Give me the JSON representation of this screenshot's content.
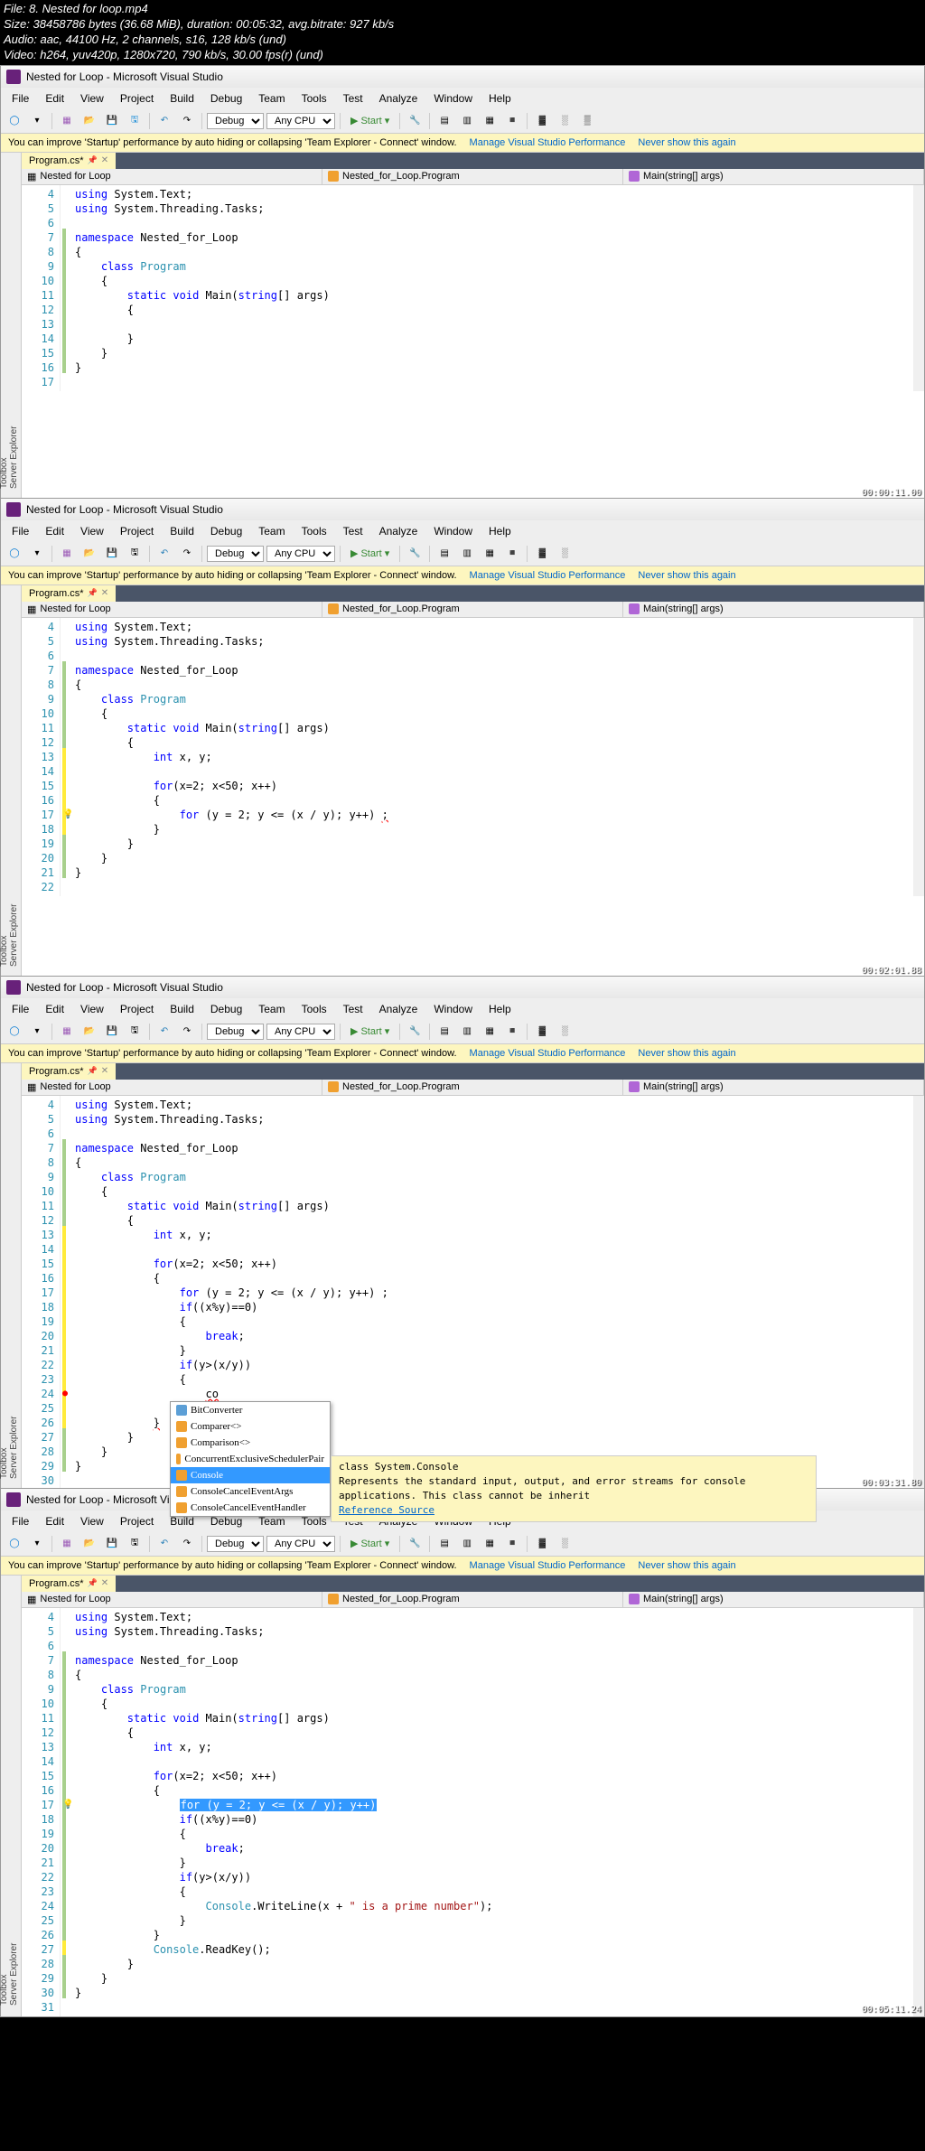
{
  "header": {
    "l1": "File: 8. Nested for loop.mp4",
    "l2": "Size: 38458786 bytes (36.68 MiB), duration: 00:05:32, avg.bitrate: 927 kb/s",
    "l3": "Audio: aac, 44100 Hz, 2 channels, s16, 128 kb/s (und)",
    "l4": "Video: h264, yuv420p, 1280x720, 790 kb/s, 30.00 fps(r) (und)"
  },
  "vs": {
    "title": "Nested for Loop - Microsoft Visual Studio",
    "menu": [
      "File",
      "Edit",
      "View",
      "Project",
      "Build",
      "Debug",
      "Team",
      "Tools",
      "Test",
      "Analyze",
      "Window",
      "Help"
    ],
    "config": "Debug",
    "platform": "Any CPU",
    "start": "Start",
    "info_msg": "You can improve 'Startup' performance by auto hiding or collapsing 'Team Explorer - Connect' window.",
    "info_link1": "Manage Visual Studio Performance",
    "info_link2": "Never show this again",
    "tab": "Program.cs*",
    "nav_scope": "Nested for Loop",
    "nav_class": "Nested_for_Loop.Program",
    "nav_method": "Main(string[] args)",
    "side1": "Server Explorer",
    "side2": "Toolbox"
  },
  "f1": {
    "ts": "00:00:11.00",
    "lines": [
      "4",
      "5",
      "6",
      "7",
      "8",
      "9",
      "10",
      "11",
      "12",
      "13",
      "14",
      "15",
      "16",
      "17"
    ]
  },
  "f2": {
    "ts": "00:02:01.88",
    "lines": [
      "4",
      "5",
      "6",
      "7",
      "8",
      "9",
      "10",
      "11",
      "12",
      "13",
      "14",
      "15",
      "16",
      "17",
      "18",
      "19",
      "20",
      "21",
      "22"
    ]
  },
  "f3": {
    "ts": "00:03:31.80",
    "lines": [
      "4",
      "5",
      "6",
      "7",
      "8",
      "9",
      "10",
      "11",
      "12",
      "13",
      "14",
      "15",
      "16",
      "17",
      "18",
      "19",
      "20",
      "21",
      "22",
      "23",
      "24",
      "25",
      "26",
      "27",
      "28",
      "29",
      "30"
    ],
    "typed": "co",
    "intelli": [
      "BitConverter",
      "Comparer<>",
      "Comparison<>",
      "ConcurrentExclusiveSchedulerPair",
      "Console",
      "ConsoleCancelEventArgs",
      "ConsoleCancelEventHandler"
    ],
    "tip_head": "class System.Console",
    "tip_body": "Represents the standard input, output, and error streams for console applications. This class cannot be inherit",
    "tip_ref": "Reference Source"
  },
  "f4": {
    "ts": "00:05:11.24",
    "lines": [
      "4",
      "5",
      "6",
      "7",
      "8",
      "9",
      "10",
      "11",
      "12",
      "13",
      "14",
      "15",
      "16",
      "17",
      "18",
      "19",
      "20",
      "21",
      "22",
      "23",
      "24",
      "25",
      "26",
      "27",
      "28",
      "29",
      "30",
      "31"
    ]
  }
}
